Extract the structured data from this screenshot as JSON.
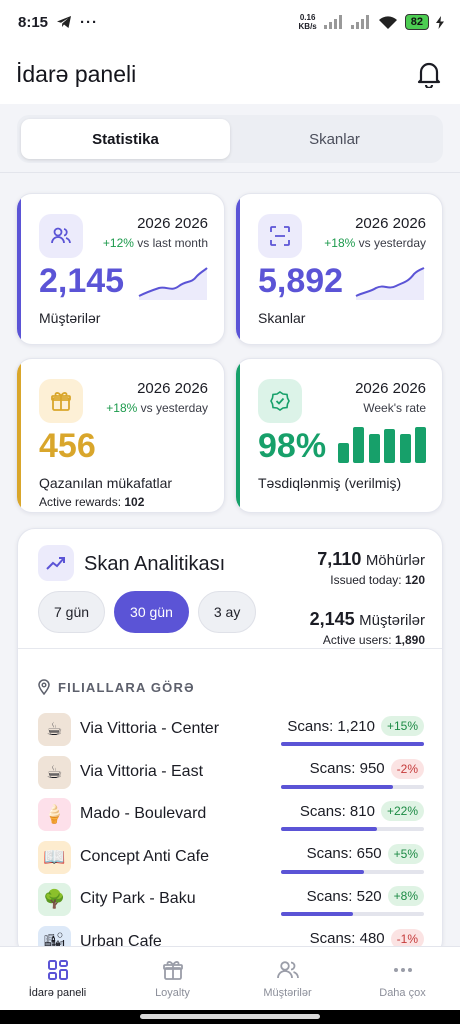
{
  "status_bar": {
    "time": "8:15",
    "speed_value": "0.16",
    "speed_unit": "KB/s",
    "battery": "82"
  },
  "header": {
    "title": "İdarə paneli",
    "bell_icon": "bell-icon"
  },
  "tabs": [
    {
      "label": "Statistika",
      "active": true
    },
    {
      "label": "Skanlar",
      "active": false
    }
  ],
  "cards": {
    "customers": {
      "year": "2026 2026",
      "delta": "+12%",
      "delta_text": "vs last month",
      "value": "2,145",
      "label": "Müştərilər",
      "color": "#5b54d6"
    },
    "scans": {
      "year": "2026 2026",
      "delta": "+18%",
      "delta_text": "vs yesterday",
      "value": "5,892",
      "label": "Skanlar",
      "color": "#5b54d6"
    },
    "rewards": {
      "year": "2026 2026",
      "delta": "+18%",
      "delta_text": "vs yesterday",
      "value": "456",
      "label": "Qazanılan mükafatlar",
      "sub_label": "Active rewards:",
      "sub_value": "102",
      "color": "#d9a62b"
    },
    "approved": {
      "year": "2026 2026",
      "delta_text": "Week's rate",
      "value": "98%",
      "label": "Təsdiqlənmiş (verilmiş)",
      "color": "#17a06a",
      "bars": [
        0.55,
        1.0,
        0.8,
        0.95,
        0.8,
        1.0
      ]
    }
  },
  "analytics": {
    "title": "Skan Analitikası",
    "stamps": {
      "value": "7,110",
      "unit": "Möhürlər",
      "sub_label": "Issued today:",
      "sub_value": "120"
    },
    "users": {
      "value": "2,145",
      "unit": "Müştərilər",
      "sub_label": "Active users:",
      "sub_value": "1,890"
    },
    "periods": [
      {
        "label": "7 gün",
        "active": false
      },
      {
        "label": "30 gün",
        "active": true
      },
      {
        "label": "3 ay",
        "active": false
      }
    ],
    "section_title": "FILIALLARA GÖRƏ",
    "branches": [
      {
        "name": "Via Vittoria - Center",
        "scans": "Scans: 1,210",
        "change": "+15%",
        "up": true,
        "share": 1.0,
        "icon": "coffee-icon",
        "bg": "#efe3d7"
      },
      {
        "name": "Via Vittoria - East",
        "scans": "Scans: 950",
        "change": "-2%",
        "up": false,
        "share": 0.78,
        "icon": "coffee-icon",
        "bg": "#efe3d7"
      },
      {
        "name": "Mado - Boulevard",
        "scans": "Scans: 810",
        "change": "+22%",
        "up": true,
        "share": 0.67,
        "icon": "ice-cream-icon",
        "bg": "#fde0ea"
      },
      {
        "name": "Concept Anti Cafe",
        "scans": "Scans: 650",
        "change": "+5%",
        "up": true,
        "share": 0.58,
        "icon": "book-icon",
        "bg": "#fdeccf"
      },
      {
        "name": "City Park - Baku",
        "scans": "Scans: 520",
        "change": "+8%",
        "up": true,
        "share": 0.5,
        "icon": "park-icon",
        "bg": "#dff3e4"
      },
      {
        "name": "Urban Cafe",
        "scans": "Scans: 480",
        "change": "-1%",
        "up": false,
        "share": 0.4,
        "icon": "city-icon",
        "bg": "#dde9f8"
      }
    ]
  },
  "bottom_nav": [
    {
      "label": "İdarə paneli",
      "icon": "dashboard-icon",
      "active": true
    },
    {
      "label": "Loyalty",
      "icon": "gift-icon",
      "active": false
    },
    {
      "label": "Müştərilər",
      "icon": "users-icon",
      "active": false
    },
    {
      "label": "Daha çox",
      "icon": "more-icon",
      "active": false
    }
  ]
}
